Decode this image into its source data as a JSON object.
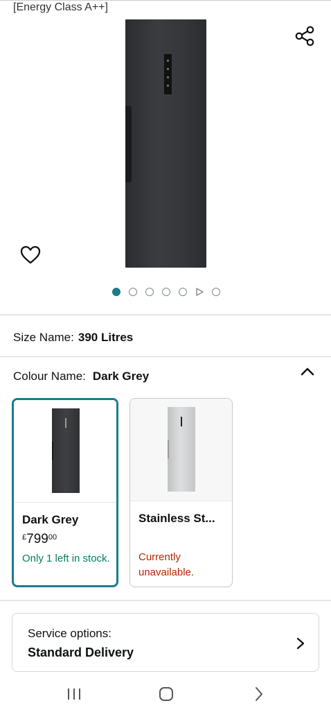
{
  "product": {
    "energy_label": "[Energy Class A++]",
    "image_pager": {
      "count": 7,
      "active_index": 0,
      "video_index": 5
    }
  },
  "size": {
    "label": "Size Name:",
    "value": "390 Litres"
  },
  "colour": {
    "label": "Colour Name:",
    "value": "Dark Grey",
    "options": [
      {
        "name": "Dark Grey",
        "price_currency": "£",
        "price_whole": "799",
        "price_fraction": "00",
        "availability": "Only 1 left in stock.",
        "selected": true
      },
      {
        "name": "Stainless St...",
        "availability": "Currently unavailable.",
        "selected": false
      }
    ]
  },
  "service": {
    "label": "Service options:",
    "value": "Standard Delivery"
  },
  "icons": {
    "share": "share-icon",
    "wishlist": "heart-icon",
    "collapse": "chevron-up-icon",
    "service_arrow": "chevron-right-icon",
    "nav_recent": "recent-apps-icon",
    "nav_home": "home-icon",
    "nav_back": "back-icon"
  },
  "colors": {
    "accent": "#1a7c8c",
    "in_stock": "#067d62",
    "unavailable": "#b12704"
  }
}
